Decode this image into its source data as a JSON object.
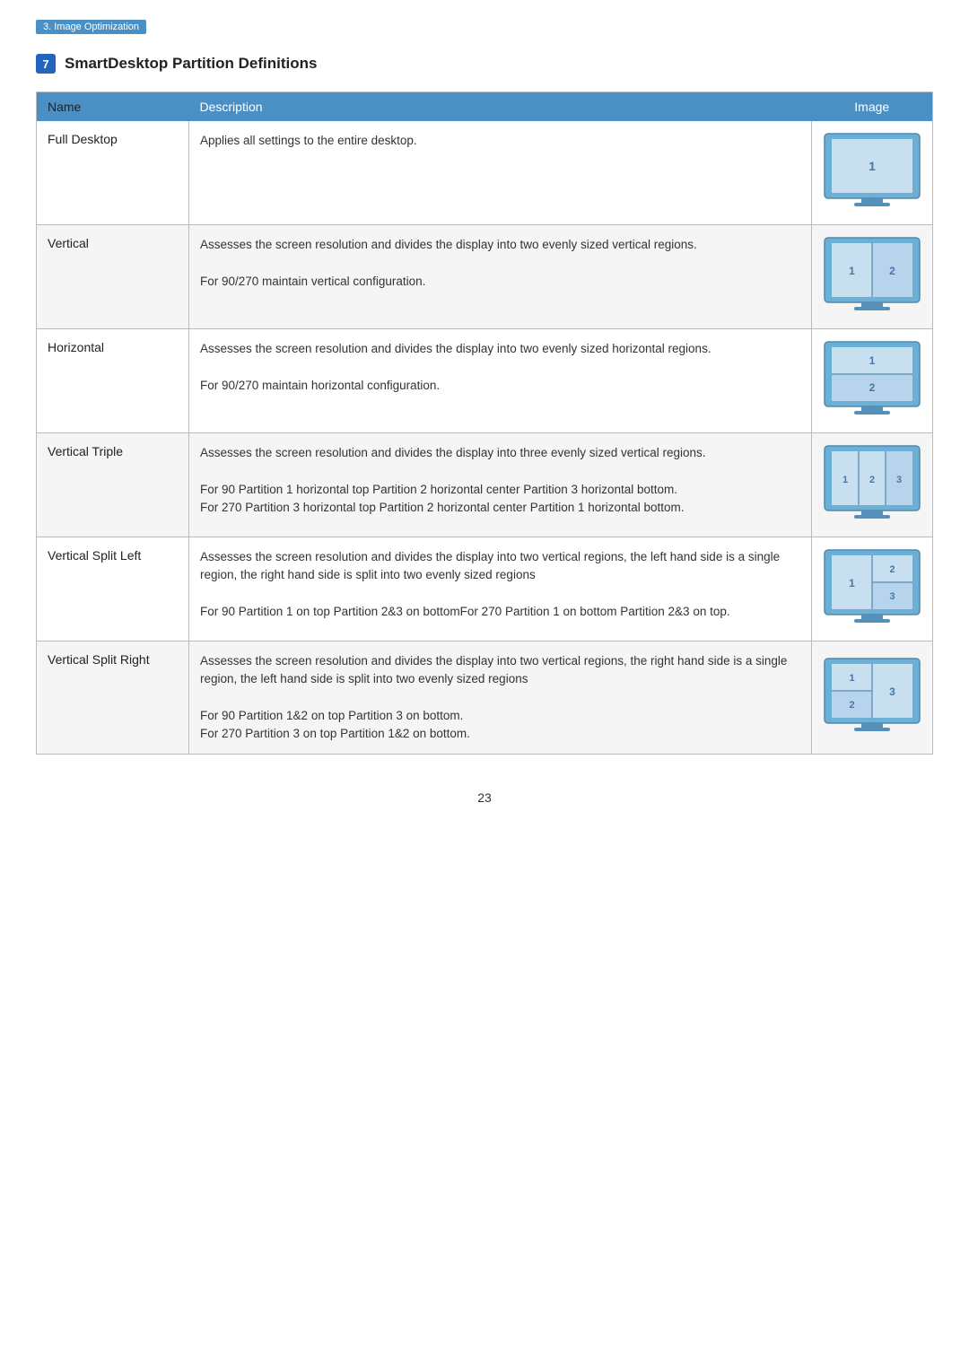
{
  "breadcrumb": "3. Image Optimization",
  "section": {
    "number": "7",
    "title": "SmartDesktop Partition Definitions"
  },
  "table": {
    "headers": [
      "Name",
      "Description",
      "Image"
    ],
    "rows": [
      {
        "name": "Full Desktop",
        "description": "Applies all settings to the entire desktop.",
        "image_type": "full_desktop"
      },
      {
        "name": "Vertical",
        "description": "Assesses the screen resolution and divides the display into two evenly sized vertical regions.\n\nFor 90/270 maintain vertical configuration.",
        "image_type": "vertical"
      },
      {
        "name": "Horizontal",
        "description": "Assesses the screen resolution and divides the display into two evenly sized horizontal regions.\n\nFor 90/270 maintain horizontal configuration.",
        "image_type": "horizontal"
      },
      {
        "name": "Vertical Triple",
        "description": "Assesses the screen resolution and divides the display into three evenly sized vertical regions.\n\nFor 90 Partition 1 horizontal top Partition 2 horizontal center Partition 3 horizontal bottom.\nFor 270 Partition 3 horizontal top Partition 2 horizontal center Partition 1 horizontal bottom.",
        "image_type": "vertical_triple"
      },
      {
        "name": "Vertical Split Left",
        "description": "Assesses the screen resolution and divides the display into two vertical regions, the left hand side is a single region, the right hand side is split into two evenly sized regions\n\nFor 90 Partition 1 on top Partition 2&3 on bottomFor 270 Partition 1 on bottom Partition 2&3 on top.",
        "image_type": "vertical_split_left"
      },
      {
        "name": "Vertical Split Right",
        "description": "Assesses the screen resolution and divides the display into two vertical regions, the right  hand side is a single region, the left  hand side is split into two evenly sized regions\n\nFor 90 Partition 1&2  on top Partition 3 on bottom.\nFor 270 Partition 3 on top Partition 1&2 on bottom.",
        "image_type": "vertical_split_right"
      }
    ]
  },
  "page_number": "23"
}
